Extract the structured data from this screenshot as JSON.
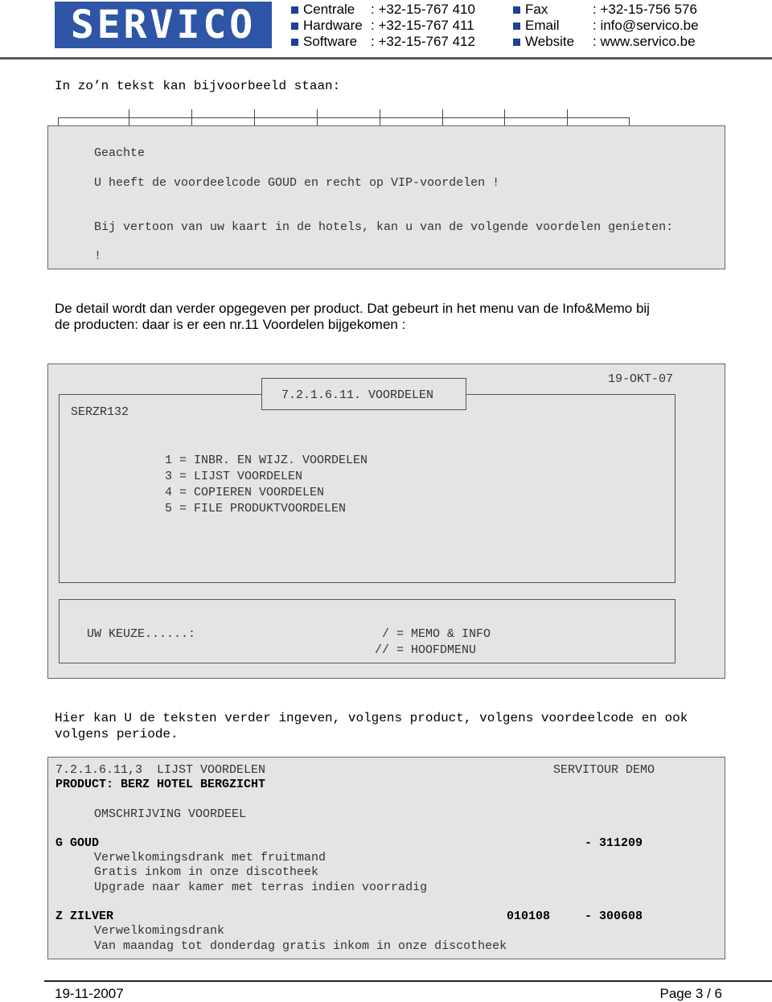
{
  "header": {
    "logo_text": "SERVICO",
    "contacts_left": [
      {
        "label": "Centrale",
        "value": ": +32-15-767 410"
      },
      {
        "label": "Hardware",
        "value": ": +32-15-767 411"
      },
      {
        "label": "Software",
        "value": ": +32-15-767 412"
      }
    ],
    "contacts_right": [
      {
        "label": "Fax",
        "value": ": +32-15-756 576"
      },
      {
        "label": "Email",
        "value": ": info@servico.be"
      },
      {
        "label": "Website",
        "value": ": www.servico.be"
      }
    ],
    "colors": {
      "brand": "#2e55a6",
      "bullet": "#1f3f99"
    }
  },
  "intro": "In zo’n tekst kan bijvoorbeeld staan:",
  "letter_panel": {
    "lines": [
      "Geachte",
      "U heeft de voordeelcode GOUD en recht op VIP-voordelen !",
      "Bij vertoon van uw kaart in de hotels, kan u van de volgende voordelen genieten:",
      "!"
    ]
  },
  "paragraph1": {
    "line1": "De detail wordt dan verder opgegeven per product. Dat gebeurt in het menu van de Info&Memo bij",
    "line2": "de producten:  daar is er een nr.11 Voordelen bijgekomen :"
  },
  "menu_screen": {
    "date": "19-OKT-07",
    "title": "7.2.1.6.11. VOORDELEN",
    "program_id": "SERZR132",
    "options": [
      "1 = INBR. EN WIJZ. VOORDELEN",
      "3 = LIJST VOORDELEN",
      "4 = COPIEREN VOORDELEN",
      "5 = FILE PRODUKTVOORDELEN"
    ],
    "prompt": "UW KEUZE......:",
    "shortcuts": [
      " / = MEMO & INFO",
      "// = HOOFDMENU"
    ]
  },
  "paragraph2": {
    "line1": "Hier kan U de teksten verder ingeven, volgens product, volgens voordeelcode en ook",
    "line2": "volgens periode."
  },
  "report": {
    "title": "7.2.1.6.11,3  LIJST VOORDELEN",
    "company": "SERVITOUR DEMO",
    "product": "PRODUCT: BERZ HOTEL BERGZICHT",
    "column_header": "OMSCHRIJVING VOORDEEL",
    "groups": [
      {
        "code": "G GOUD",
        "from": "",
        "to": "- 311209",
        "items": [
          "Verwelkomingsdrank met fruitmand",
          "Gratis inkom in onze discotheek",
          "Upgrade naar kamer met terras indien voorradig"
        ]
      },
      {
        "code": "Z ZILVER",
        "from": "010108",
        "to": "- 300608",
        "items": [
          "Verwelkomingsdrank",
          "Van maandag tot donderdag gratis inkom in onze discotheek"
        ]
      }
    ]
  },
  "footer": {
    "date": "19-11-2007",
    "page": "Page 3 / 6"
  }
}
